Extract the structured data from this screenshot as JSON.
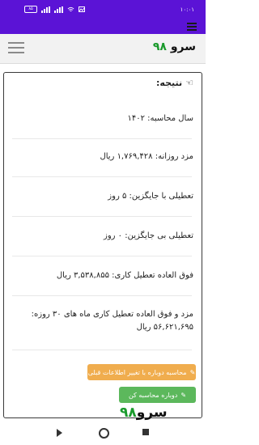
{
  "status_bar": {
    "time": "۱۰:۰۱",
    "battery": "۸۵"
  },
  "header": {
    "brand_name": "سرو",
    "brand_number": "۹۸",
    "accent_color": "#1a9a2c",
    "bar_color": "#5b13d6"
  },
  "result": {
    "title": "نتیجه:",
    "items": [
      "سال محاسبه: ۱۴۰۲",
      "مزد روزانه: ۱,۷۶۹,۴۲۸ ریال",
      "تعطیلی با جایگزین: ۵ روز",
      "تعطیلی بی جایگزین: ۰ روز",
      "فوق العاده تعطیل کاری: ۳,۵۳۸,۸۵۵ ریال",
      "مزد و فوق العاده تعطیل کاری ماه های ۳۰ روزه: ۵۶,۶۲۱,۶۹۵ ریال"
    ]
  },
  "buttons": {
    "recalc_change": "محاسبه دوباره با تغییر اطلاعات قبلی",
    "recalc": "دوباره محاسبه کن"
  },
  "watermark": {
    "number": "۹۸",
    "name": "سرو"
  },
  "icons": {
    "menu": "hamburger-icon",
    "pointer": "hand-pointer-icon",
    "edit": "pencil-icon"
  }
}
